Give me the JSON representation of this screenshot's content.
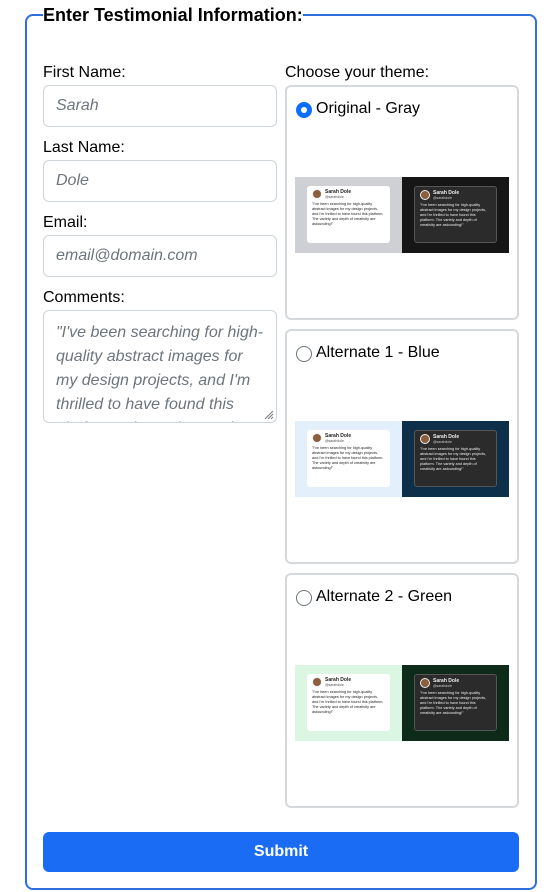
{
  "form": {
    "legend": "Enter Testimonial Information:",
    "first_name": {
      "label": "First Name:",
      "placeholder": "Sarah"
    },
    "last_name": {
      "label": "Last Name:",
      "placeholder": "Dole"
    },
    "email": {
      "label": "Email:",
      "placeholder": "email@domain.com"
    },
    "comments": {
      "label": "Comments:",
      "placeholder": "\"I've been searching for high-quality abstract images for my design projects, and I'm thrilled to have found this platform. The variety and depth of creativity are astounding!\""
    },
    "submit_label": "Submit"
  },
  "themes": {
    "label": "Choose your theme:",
    "selected": "Original - Gray",
    "options": [
      {
        "name": "Original - Gray",
        "checked": true,
        "light_bg": "#cfd0d3",
        "dark_bg": "#161616"
      },
      {
        "name": "Alternate 1 - Blue",
        "checked": false,
        "light_bg": "#e3f0fb",
        "dark_bg": "#0e2f4a"
      },
      {
        "name": "Alternate 2 - Green",
        "checked": false,
        "light_bg": "#dcf6e4",
        "dark_bg": "#0d2b18"
      }
    ],
    "preview": {
      "name": "Sarah Dole",
      "handle": "@sarahdole",
      "quote": "\"I've been searching for high-quality abstract images for my design projects, and I'm thrilled to have found this platform. The variety and depth of creativity are astounding!\""
    }
  },
  "colors": {
    "accent": "#1a6cf5",
    "border": "#2f6fdd"
  }
}
